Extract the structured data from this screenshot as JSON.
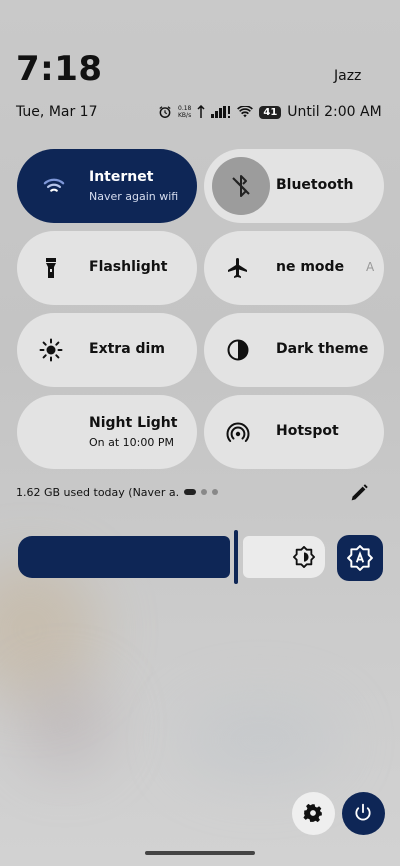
{
  "status": {
    "time": "7:18",
    "carrier": "Jazz",
    "date": "Tue, Mar 17",
    "net_speed_value": "0.18",
    "net_speed_unit": "KB/s",
    "battery": "41",
    "alarm_text": "Until 2:00 AM"
  },
  "tiles": [
    {
      "label": "Internet",
      "sub": "Naver again wifi",
      "icon": "wifi-icon",
      "active": true
    },
    {
      "label": "Bluetooth",
      "icon": "bluetooth-off-icon",
      "active": false
    },
    {
      "label": "Flashlight",
      "icon": "flashlight-icon",
      "active": false
    },
    {
      "label": "ne mode",
      "trailing": "A",
      "icon": "airplane-icon",
      "active": false
    },
    {
      "label": "Extra dim",
      "icon": "brightness-icon",
      "active": false
    },
    {
      "label": "Dark theme",
      "icon": "dark-theme-icon",
      "active": false
    },
    {
      "label": "Night Light",
      "sub": "On at 10:00 PM",
      "icon": "moon-icon",
      "active": false
    },
    {
      "label": "Hotspot",
      "icon": "hotspot-icon",
      "active": false
    }
  ],
  "data_usage": "1.62 GB used today (Naver a.",
  "brightness": {
    "level": 0.72
  },
  "colors": {
    "accent": "#0e2656",
    "tile": "#e3e3e3",
    "background": "#c8c8c8"
  }
}
